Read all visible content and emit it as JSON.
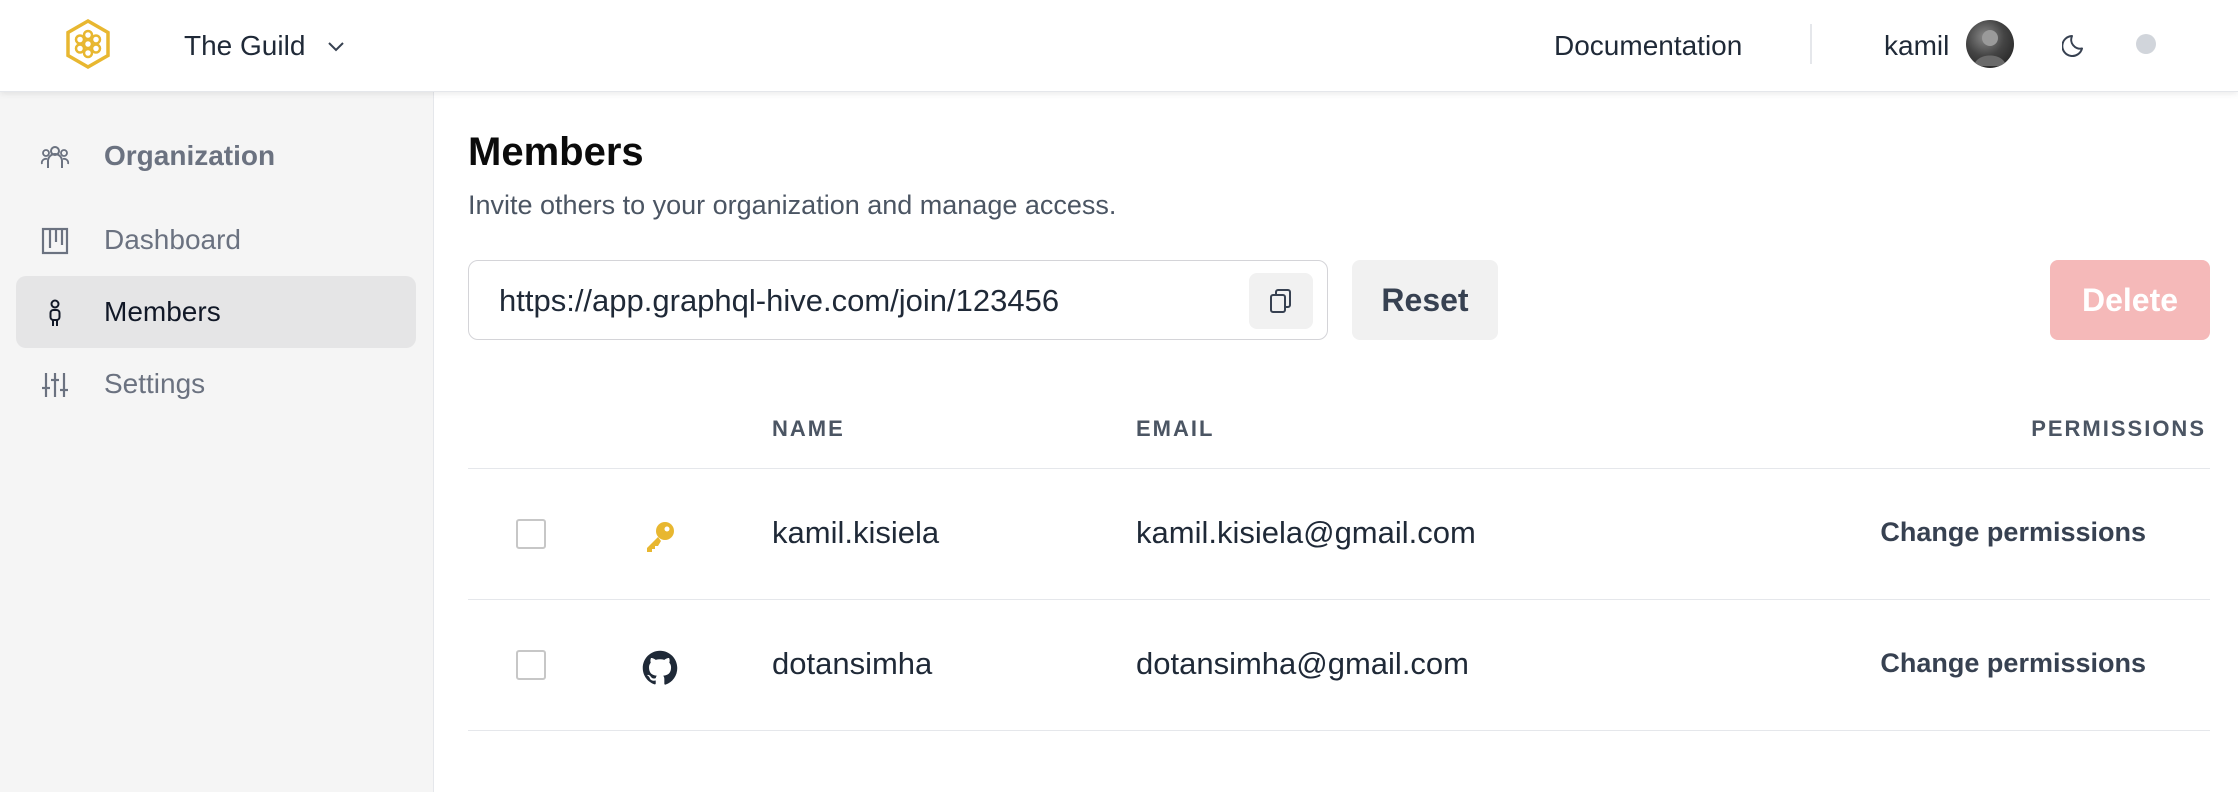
{
  "header": {
    "org_name": "The Guild",
    "documentation_label": "Documentation",
    "user_name": "kamil"
  },
  "sidebar": {
    "items": [
      {
        "label": "Organization",
        "icon": "people-icon"
      },
      {
        "label": "Dashboard",
        "icon": "board-icon"
      },
      {
        "label": "Members",
        "icon": "person-icon",
        "active": true
      },
      {
        "label": "Settings",
        "icon": "sliders-icon"
      }
    ]
  },
  "main": {
    "title": "Members",
    "subtitle": "Invite others to your organization and manage access.",
    "invite_url": "https://app.graphql-hive.com/join/123456",
    "reset_label": "Reset",
    "delete_label": "Delete",
    "columns": {
      "name": "NAME",
      "email": "EMAIL",
      "permissions": "PERMISSIONS"
    },
    "members": [
      {
        "name": "kamil.kisiela",
        "email": "kamil.kisiela@gmail.com",
        "provider_icon": "key-icon",
        "action": "Change permissions"
      },
      {
        "name": "dotansimha",
        "email": "dotansimha@gmail.com",
        "provider_icon": "github-icon",
        "action": "Change permissions"
      }
    ]
  },
  "colors": {
    "brand": "#e8b730",
    "delete_disabled": "#f5b9b9",
    "sidebar_bg": "#f5f5f5",
    "active_item_bg": "#e5e5e6"
  }
}
